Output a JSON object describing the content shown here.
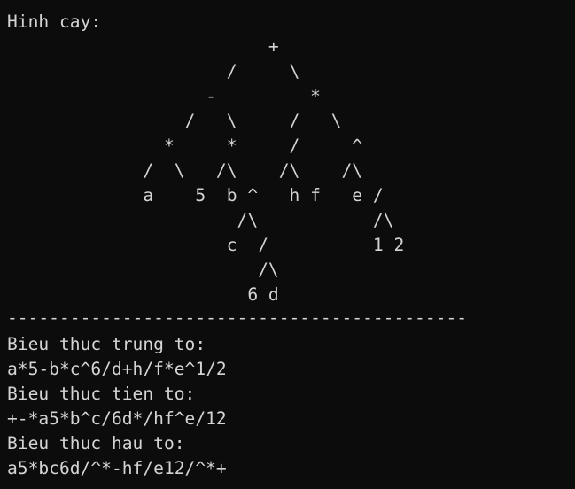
{
  "console": {
    "tree_title": "Hinh cay:",
    "tree_lines": [
      "                         +",
      "                     /     \\",
      "                   -         *",
      "                 /   \\     /   \\",
      "               *     *     /     ^",
      "             /  \\   /\\    /\\    /\\",
      "             a    5  b ^   h f   e /",
      "                      /\\           /\\",
      "                     c  /          1 2",
      "                        /\\",
      "                       6 d"
    ],
    "separator": "--------------------------------------------",
    "infix_label": "Bieu thuc trung to:",
    "infix_value": "a*5-b*c^6/d+h/f*e^1/2",
    "prefix_label": "Bieu thuc tien to:",
    "prefix_value": "+-*a5*b^c/6d*/hf^e/12",
    "postfix_label": "Bieu thuc hau to:",
    "postfix_value": "a5*bc6d/^*-hf/e12/^*+"
  }
}
